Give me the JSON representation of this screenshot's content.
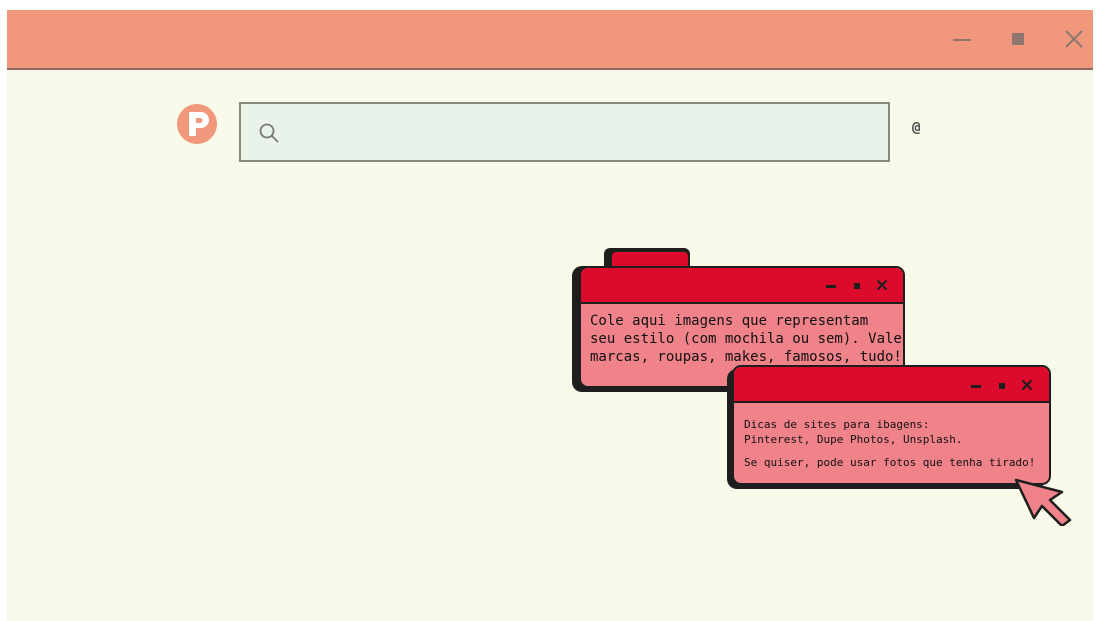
{
  "window": {
    "controls": {
      "minimize_icon": "minimize-icon",
      "maximize_icon": "maximize-icon",
      "close_icon": "close-icon"
    }
  },
  "logo": {
    "letter": "P",
    "color": "#f0977c"
  },
  "search": {
    "value": "",
    "placeholder": ""
  },
  "at_symbol": "@",
  "popup_main": {
    "text_line1": "Cole aqui imagens que representam",
    "text_line2": "seu estilo (com mochila ou sem). Vale",
    "text_line3": "marcas, roupas, makes, famosos, tudo!"
  },
  "popup_tips": {
    "text_line1": "Dicas de sites para ibagens:",
    "text_line2": "Pinterest, Dupe Photos, Unsplash.",
    "text_line3": "Se quiser, pode usar fotos que tenha tirado!"
  },
  "colors": {
    "titlebar": "#f0977c",
    "background": "#f9f9ea",
    "search_bg": "#eaf3e9",
    "popup_header": "#dc0a2b",
    "popup_body": "#f0828a",
    "cursor_fill": "#f0828a"
  }
}
